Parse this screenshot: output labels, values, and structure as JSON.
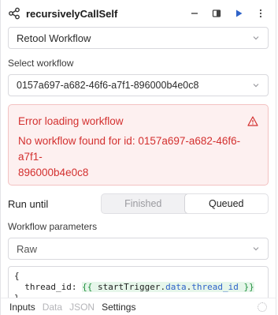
{
  "header": {
    "title": "recursivelyCallSelf"
  },
  "resource_select": {
    "value": "Retool Workflow"
  },
  "workflow": {
    "label": "Select workflow",
    "value": "0157a697-a682-46f6-a7f1-896000b4e0c8"
  },
  "error": {
    "title": "Error loading workflow",
    "message_line1": "No workflow found for id: 0157a697-a682-46f6-a7f1-",
    "message_line2": "896000b4e0c8"
  },
  "run_until": {
    "label": "Run until",
    "options": [
      "Finished",
      "Queued"
    ],
    "selected": "Queued"
  },
  "params": {
    "label": "Workflow parameters",
    "mode": "Raw",
    "code": {
      "open": "{",
      "key": "thread_id:",
      "tmpl_open": "{{",
      "obj": "startTrigger",
      "dot1": ".",
      "p1": "data",
      "dot2": ".",
      "p2": "thread_id",
      "tmpl_close": "}}",
      "close": "}"
    }
  },
  "tabs": {
    "items": [
      "Inputs",
      "Data",
      "JSON",
      "Settings"
    ],
    "active": [
      "Inputs",
      "Settings"
    ]
  },
  "colors": {
    "accent": "#2f63c9",
    "error": "#d3302f"
  }
}
